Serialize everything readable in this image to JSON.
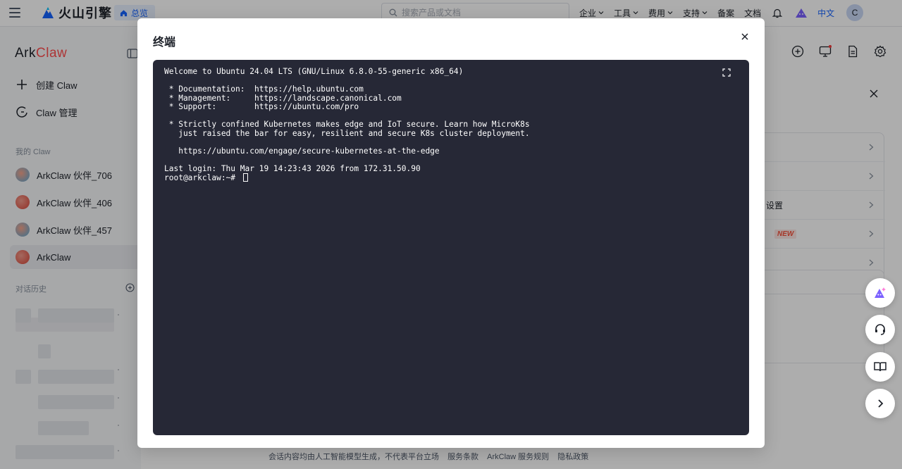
{
  "topbar": {
    "brand_name": "火山引擎",
    "overview_label": "总览",
    "search_placeholder": "搜索产品或文档",
    "nav": [
      {
        "label": "企业"
      },
      {
        "label": "工具"
      },
      {
        "label": "费用"
      },
      {
        "label": "支持"
      }
    ],
    "links": [
      "备案",
      "文档"
    ],
    "language": "中文",
    "avatar_initial": "C"
  },
  "sidebar": {
    "logo_ark": "Ark",
    "logo_claw": "Claw",
    "create_label": "创建 Claw",
    "manage_label": "Claw 管理",
    "my_claw_title": "我的 Claw",
    "claws": [
      {
        "label": "ArkClaw 伙伴_706"
      },
      {
        "label": "ArkClaw 伙伴_406"
      },
      {
        "label": "ArkClaw 伙伴_457"
      },
      {
        "label": "ArkClaw"
      }
    ],
    "history_title": "对话历史"
  },
  "panel": {
    "rows": [
      {
        "label": ""
      },
      {
        "label": ""
      },
      {
        "label": "设置"
      },
      {
        "label": "",
        "badge": "NEW"
      },
      {
        "label": ""
      }
    ]
  },
  "footer": {
    "disclaimer": "会话内容均由人工智能模型生成，不代表平台立场",
    "terms": "服务条款",
    "rules": "ArkClaw 服务规则",
    "privacy": "隐私政策"
  },
  "modal": {
    "title": "终端",
    "terminal_lines": [
      "Welcome to Ubuntu 24.04 LTS (GNU/Linux 6.8.0-55-generic x86_64)",
      "",
      " * Documentation:  https://help.ubuntu.com",
      " * Management:     https://landscape.canonical.com",
      " * Support:        https://ubuntu.com/pro",
      "",
      " * Strictly confined Kubernetes makes edge and IoT secure. Learn how MicroK8s",
      "   just raised the bar for easy, resilient and secure K8s cluster deployment.",
      "",
      "   https://ubuntu.com/engage/secure-kubernetes-at-the-edge",
      "",
      "Last login: Thu Mar 19 14:23:43 2026 from 172.31.50.90"
    ],
    "prompt": "root@arkclaw:~# "
  },
  "colors": {
    "brand_blue": "#1664ff",
    "claw_red": "#ff4d4f",
    "terminal_bg": "#262836",
    "new_badge": "#f5533d"
  },
  "icons": [
    "menu-icon",
    "volcano-logo-icon",
    "home-icon",
    "search-icon",
    "bell-icon",
    "mascot-icon",
    "plus-icon",
    "claw-manage-icon",
    "collapse-sidebar-icon",
    "new-chat-icon",
    "screen-icon",
    "document-icon",
    "settings-icon",
    "close-icon",
    "fullscreen-icon",
    "ai-assistant-icon",
    "headset-icon",
    "book-icon",
    "chevron-right-icon"
  ]
}
